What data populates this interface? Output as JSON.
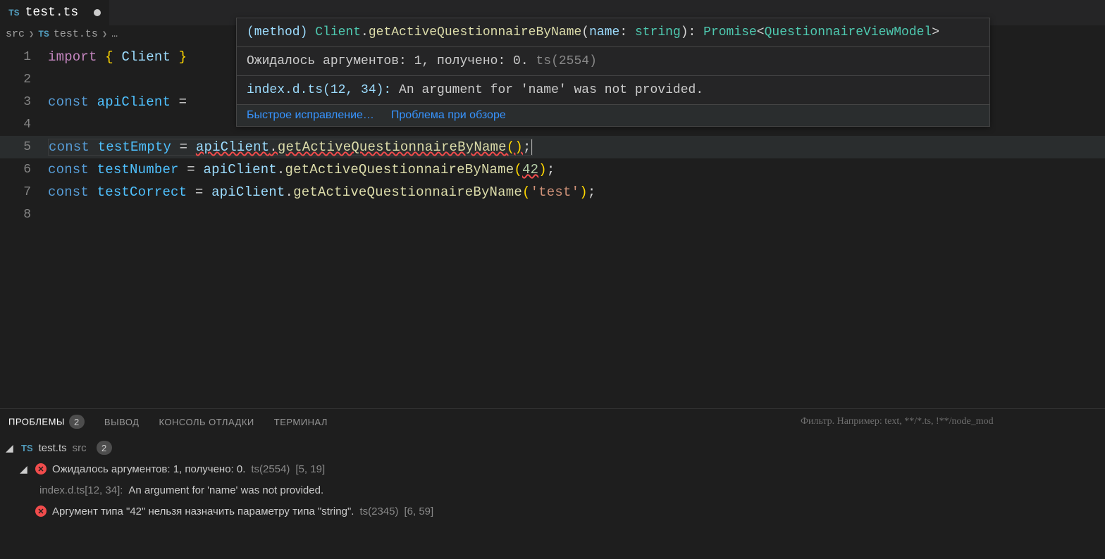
{
  "tab": {
    "icon": "TS",
    "name": "test.ts"
  },
  "breadcrumb": {
    "root": "src",
    "icon": "TS",
    "file": "test.ts",
    "more": "…"
  },
  "lines": {
    "n1": "1",
    "n2": "2",
    "n3": "3",
    "n4": "4",
    "n5": "5",
    "n6": "6",
    "n7": "7",
    "n8": "8"
  },
  "code": {
    "import": "import",
    "lbrace": "{ ",
    "Client": "Client",
    "rbrace": " }",
    "const": "const",
    "apiClient": "apiClient",
    "eq": "=",
    "testEmpty": "testEmpty",
    "testNumber": "testNumber",
    "testCorrect": "testCorrect",
    "call1": "apiClient",
    "dot": ".",
    "method": "getActiveQuestionnaireByName",
    "lp": "(",
    "rp": ")",
    "semi": ";",
    "num42": "42",
    "strTest": "'test'"
  },
  "hover": {
    "sig_kind": "(method) ",
    "sig_class": "Client",
    "sig_dot": ".",
    "sig_method": "getActiveQuestionnaireByName",
    "sig_lp": "(",
    "sig_param": "name",
    "sig_colon": ": ",
    "sig_ptype": "string",
    "sig_rp": "): ",
    "sig_promise": "Promise",
    "sig_lt": "<",
    "sig_model": "QuestionnaireViewModel",
    "sig_gt": ">",
    "err_msg": "Ожидалось аргументов: 1, получено: 0. ",
    "err_code": "ts(2554)",
    "rel_file": "index.d.ts(12, 34): ",
    "rel_msg": "An argument for 'name' was not provided.",
    "action_fix": "Быстрое исправление…",
    "action_peek": "Проблема при обзоре"
  },
  "panel": {
    "tab_problems": "ПРОБЛЕМЫ",
    "problems_count": "2",
    "tab_output": "ВЫВОД",
    "tab_debug": "КОНСОЛЬ ОТЛАДКИ",
    "tab_terminal": "ТЕРМИНАЛ",
    "filter_placeholder": "Фильтр. Например: text, **/*.ts, !**/node_mod",
    "file_icon": "TS",
    "file_name": "test.ts",
    "file_dir": "src",
    "file_count": "2",
    "p1_msg": "Ожидалось аргументов: 1, получено: 0.",
    "p1_src": "ts(2554)",
    "p1_loc": "[5, 19]",
    "p1_rel_file": "index.d.ts[12, 34]:",
    "p1_rel_msg": " An argument for 'name' was not provided.",
    "p2_msg": "Аргумент типа \"42\" нельзя назначить параметру типа \"string\".",
    "p2_src": "ts(2345)",
    "p2_loc": "[6, 59]"
  }
}
